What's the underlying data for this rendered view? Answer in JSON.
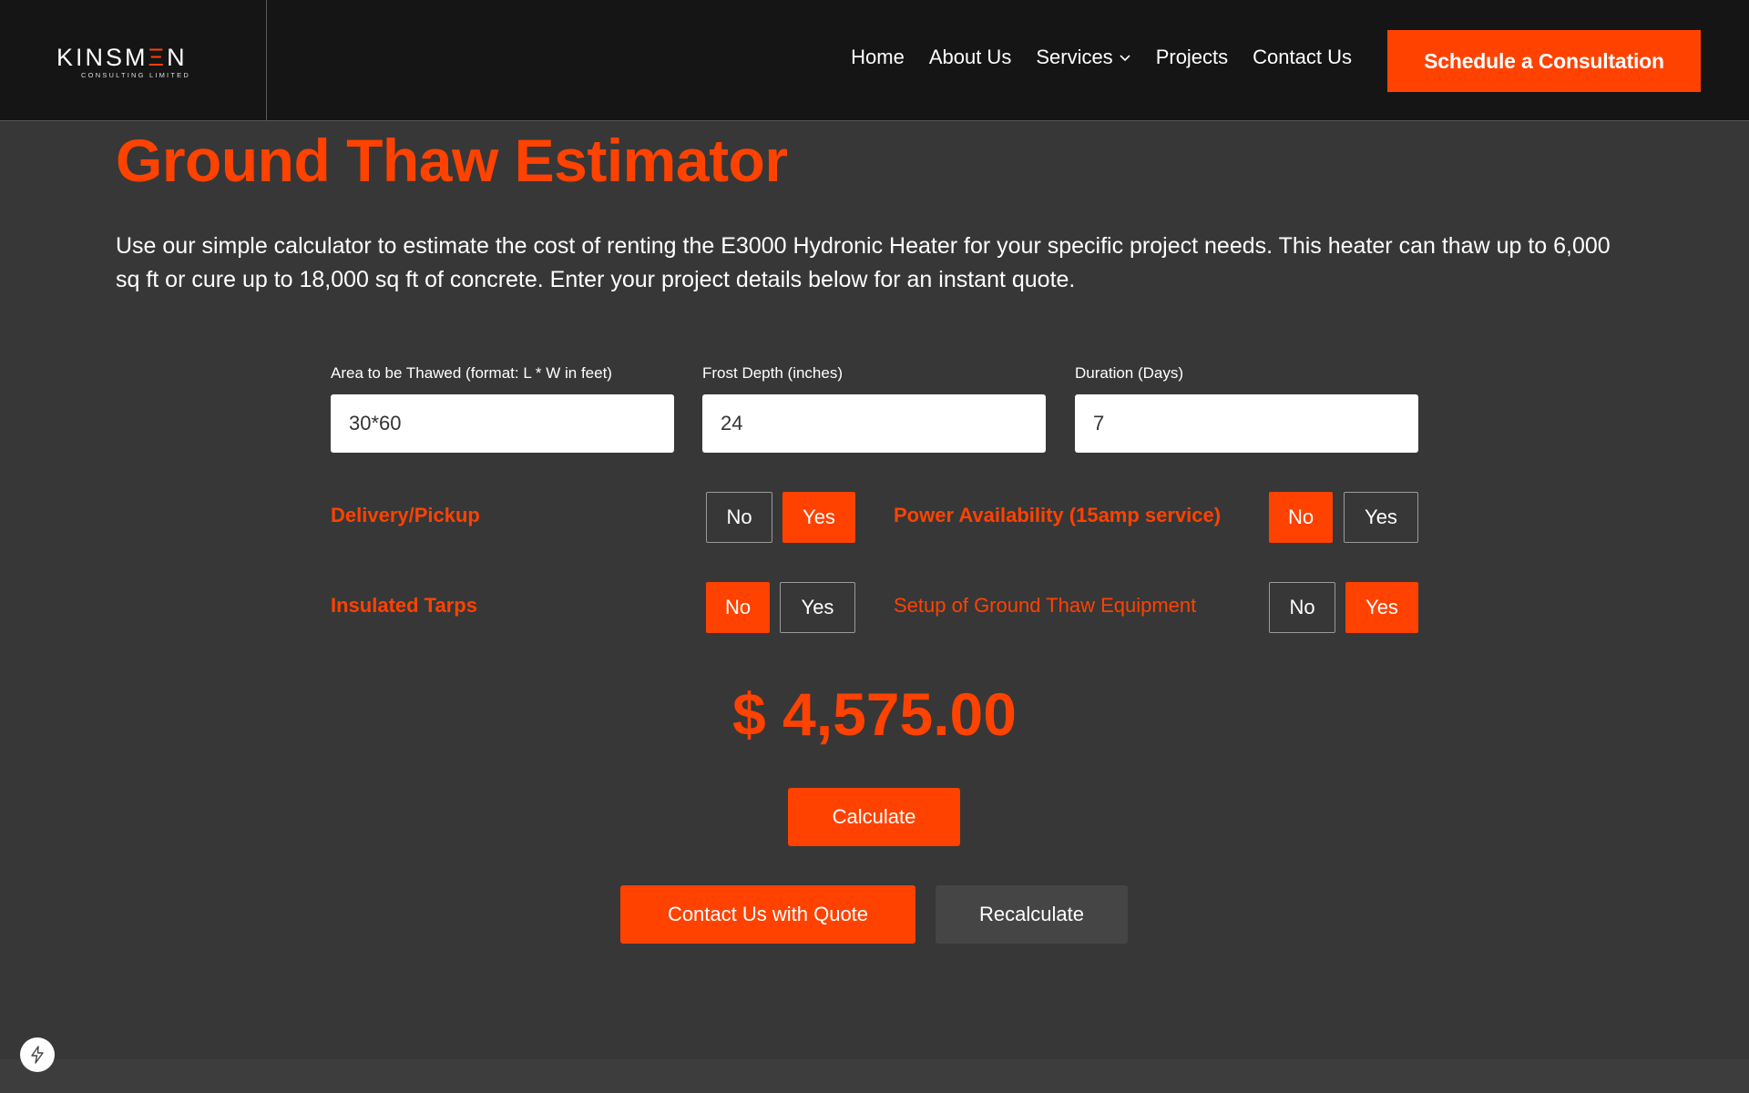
{
  "header": {
    "logo": {
      "main_prefix": "KINSM",
      "main_accent": "Ξ",
      "main_suffix": "N",
      "sub": "CONSULTING LIMITED"
    },
    "nav": [
      {
        "label": "Home"
      },
      {
        "label": "About Us"
      },
      {
        "label": "Services"
      },
      {
        "label": "Projects"
      },
      {
        "label": "Contact Us"
      }
    ],
    "cta_label": "Schedule a Consultation"
  },
  "main": {
    "title": "Ground Thaw Estimator",
    "intro": "Use our simple calculator to estimate the cost of renting the E3000 Hydronic Heater for your specific project needs. This heater can thaw up to 6,000 sq ft or cure up to 18,000 sq ft of concrete. Enter your project details below for an instant quote.",
    "fields": {
      "area": {
        "label": "Area to be Thawed (format: L * W in feet)",
        "value": "30*60"
      },
      "depth": {
        "label": "Frost Depth (inches)",
        "value": "24"
      },
      "duration": {
        "label": "Duration (Days)",
        "value": "7"
      }
    },
    "options": {
      "delivery": {
        "label": "Delivery/Pickup",
        "selected": "Yes"
      },
      "power": {
        "label": "Power Availability (15amp service)",
        "selected": "No"
      },
      "tarps": {
        "label": "Insulated Tarps",
        "selected": "No"
      },
      "setup": {
        "label": "Setup of Ground Thaw Equipment",
        "selected": "Yes"
      }
    },
    "toggle_labels": {
      "no": "No",
      "yes": "Yes"
    },
    "price": "$ 4,575.00",
    "buttons": {
      "calculate": "Calculate",
      "contact_quote": "Contact Us with Quote",
      "recalculate": "Recalculate"
    }
  },
  "colors": {
    "accent": "#ff4200",
    "background": "#373737",
    "header": "#151515"
  },
  "icons": {
    "services_dropdown": "chevron-down-icon",
    "corner_badge": "lightning-bolt-icon"
  }
}
